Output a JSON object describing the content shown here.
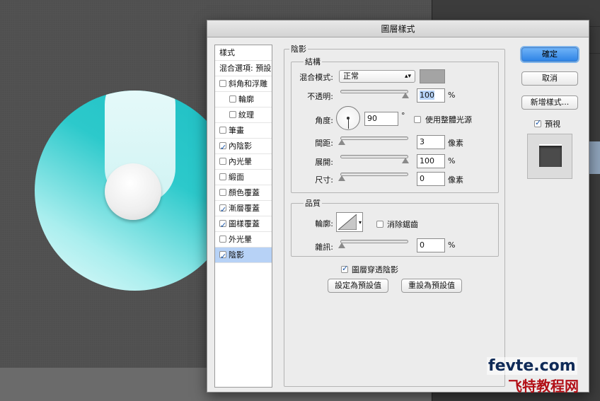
{
  "dialog": {
    "title": "圖層樣式",
    "styles": {
      "header1": "樣式",
      "header2": "混合選項: 預設",
      "items": [
        {
          "label": "斜角和浮雕",
          "checked": false,
          "indent": 0
        },
        {
          "label": "輪廓",
          "checked": false,
          "indent": 1
        },
        {
          "label": "紋理",
          "checked": false,
          "indent": 1
        },
        {
          "label": "筆畫",
          "checked": false,
          "indent": 0
        },
        {
          "label": "內陰影",
          "checked": true,
          "indent": 0
        },
        {
          "label": "內光暈",
          "checked": false,
          "indent": 0
        },
        {
          "label": "緞面",
          "checked": false,
          "indent": 0
        },
        {
          "label": "顏色覆蓋",
          "checked": false,
          "indent": 0
        },
        {
          "label": "漸層覆蓋",
          "checked": true,
          "indent": 0
        },
        {
          "label": "圖樣覆蓋",
          "checked": true,
          "indent": 0
        },
        {
          "label": "外光暈",
          "checked": false,
          "indent": 0
        },
        {
          "label": "陰影",
          "checked": true,
          "indent": 0,
          "selected": true
        }
      ]
    },
    "section_title": "陰影",
    "structure": {
      "legend": "結構",
      "blend_mode_label": "混合模式:",
      "blend_mode_value": "正常",
      "shadow_color": "#a4a4a4",
      "opacity_label": "不透明:",
      "opacity_value": "100",
      "opacity_unit": "%",
      "angle_label": "角度:",
      "angle_value": "90",
      "angle_unit": "°",
      "global_light_label": "使用整體光源",
      "distance_label": "間距:",
      "distance_value": "3",
      "distance_unit": "像素",
      "spread_label": "展開:",
      "spread_value": "100",
      "spread_unit": "%",
      "size_label": "尺寸:",
      "size_value": "0",
      "size_unit": "像素"
    },
    "quality": {
      "legend": "品質",
      "contour_label": "輪廓:",
      "anti_alias_label": "消除鋸齒",
      "noise_label": "雜訊:",
      "noise_value": "0",
      "noise_unit": "%"
    },
    "layer_knocks_out_label": "圖層穿透陰影",
    "make_default_label": "設定為預設值",
    "reset_default_label": "重設為預設值",
    "ok_label": "確定",
    "cancel_label": "取消",
    "new_style_label": "新增樣式...",
    "preview_label": "預視"
  },
  "watermark": {
    "line1": "fevte.com",
    "line2": "飞特教程网"
  }
}
